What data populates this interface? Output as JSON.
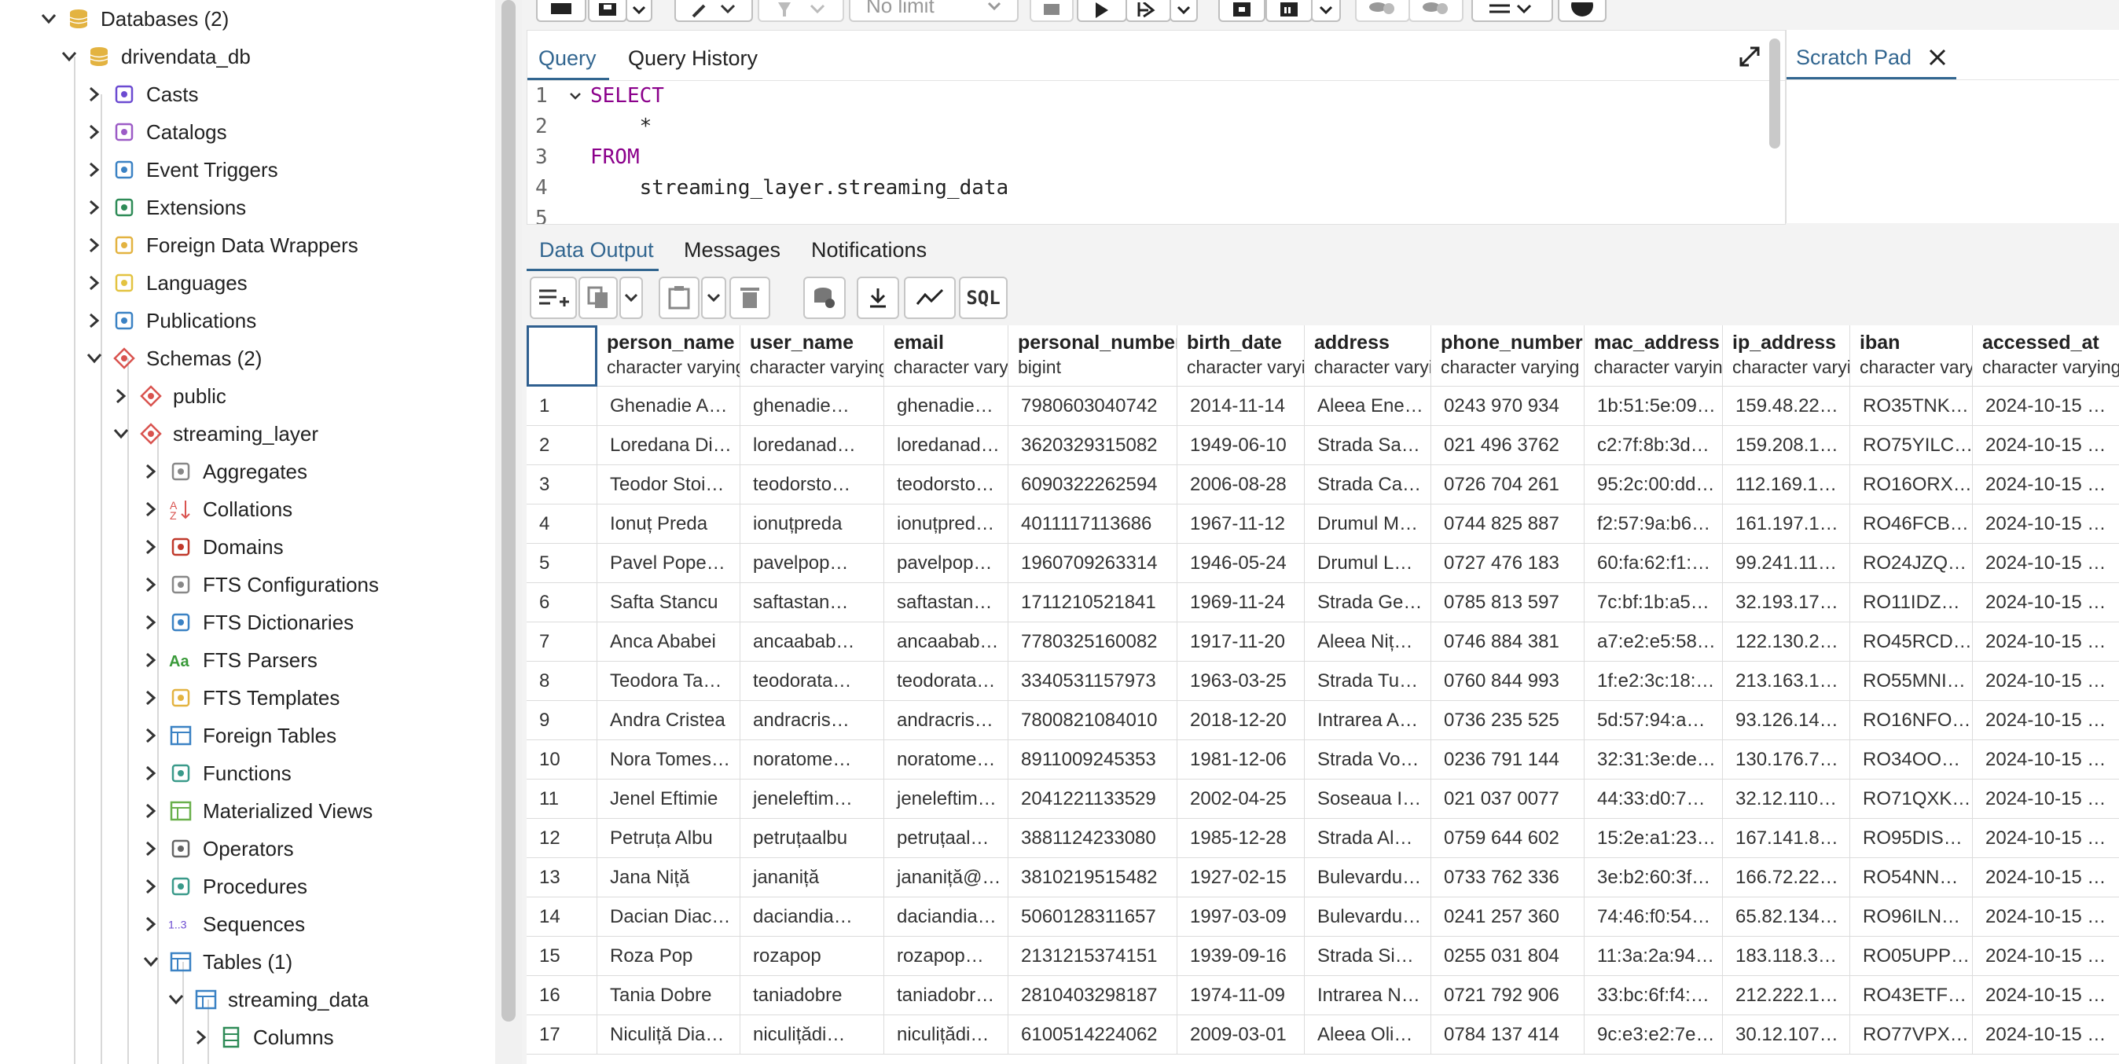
{
  "sidebar": {
    "items": [
      {
        "label": "Databases (2)",
        "icon": "databases-icon",
        "state": "expanded"
      },
      {
        "label": "drivendata_db",
        "icon": "database-icon",
        "state": "expanded"
      },
      {
        "label": "Casts",
        "icon": "casts-icon",
        "state": "collapsed"
      },
      {
        "label": "Catalogs",
        "icon": "catalogs-icon",
        "state": "collapsed"
      },
      {
        "label": "Event Triggers",
        "icon": "event-triggers-icon",
        "state": "collapsed"
      },
      {
        "label": "Extensions",
        "icon": "extensions-icon",
        "state": "collapsed"
      },
      {
        "label": "Foreign Data Wrappers",
        "icon": "foreign-data-wrappers-icon",
        "state": "collapsed"
      },
      {
        "label": "Languages",
        "icon": "languages-icon",
        "state": "collapsed"
      },
      {
        "label": "Publications",
        "icon": "publications-icon",
        "state": "collapsed"
      },
      {
        "label": "Schemas (2)",
        "icon": "schemas-icon",
        "state": "expanded"
      },
      {
        "label": "public",
        "icon": "schema-icon",
        "state": "collapsed"
      },
      {
        "label": "streaming_layer",
        "icon": "schema-icon",
        "state": "expanded"
      },
      {
        "label": "Aggregates",
        "icon": "aggregates-icon",
        "state": "collapsed"
      },
      {
        "label": "Collations",
        "icon": "collations-icon",
        "state": "collapsed"
      },
      {
        "label": "Domains",
        "icon": "domains-icon",
        "state": "collapsed"
      },
      {
        "label": "FTS Configurations",
        "icon": "fts-configurations-icon",
        "state": "collapsed"
      },
      {
        "label": "FTS Dictionaries",
        "icon": "fts-dictionaries-icon",
        "state": "collapsed"
      },
      {
        "label": "FTS Parsers",
        "icon": "fts-parsers-icon",
        "state": "collapsed"
      },
      {
        "label": "FTS Templates",
        "icon": "fts-templates-icon",
        "state": "collapsed"
      },
      {
        "label": "Foreign Tables",
        "icon": "foreign-tables-icon",
        "state": "collapsed"
      },
      {
        "label": "Functions",
        "icon": "functions-icon",
        "state": "collapsed"
      },
      {
        "label": "Materialized Views",
        "icon": "materialized-views-icon",
        "state": "collapsed"
      },
      {
        "label": "Operators",
        "icon": "operators-icon",
        "state": "collapsed"
      },
      {
        "label": "Procedures",
        "icon": "procedures-icon",
        "state": "collapsed"
      },
      {
        "label": "Sequences",
        "icon": "sequences-icon",
        "state": "collapsed"
      },
      {
        "label": "Tables (1)",
        "icon": "tables-icon",
        "state": "expanded"
      },
      {
        "label": "streaming_data",
        "icon": "table-icon",
        "state": "expanded"
      },
      {
        "label": "Columns",
        "icon": "columns-icon",
        "state": "collapsed"
      }
    ]
  },
  "toolbar": {
    "limit_value": "No limit"
  },
  "editor": {
    "tabs": [
      "Query",
      "Query History"
    ],
    "lines": [
      {
        "num": "1",
        "text": "SELECT",
        "keyword": true
      },
      {
        "num": "2",
        "text": "    *",
        "keyword": false
      },
      {
        "num": "3",
        "text": "FROM",
        "keyword": true
      },
      {
        "num": "4",
        "text": "    streaming_layer.streaming_data",
        "keyword": false
      },
      {
        "num": "5",
        "text": "",
        "keyword": false
      }
    ]
  },
  "scratch_pad": {
    "title": "Scratch Pad"
  },
  "output": {
    "tabs": [
      "Data Output",
      "Messages",
      "Notifications"
    ],
    "sql_button": "SQL"
  },
  "grid": {
    "columns": [
      {
        "name": "person_name",
        "type": "character varying"
      },
      {
        "name": "user_name",
        "type": "character varying"
      },
      {
        "name": "email",
        "type": "character varying"
      },
      {
        "name": "personal_number",
        "type": "bigint"
      },
      {
        "name": "birth_date",
        "type": "character varying"
      },
      {
        "name": "address",
        "type": "character varying"
      },
      {
        "name": "phone_number",
        "type": "character varying"
      },
      {
        "name": "mac_address",
        "type": "character varying"
      },
      {
        "name": "ip_address",
        "type": "character varying"
      },
      {
        "name": "iban",
        "type": "character varying"
      },
      {
        "name": "accessed_at",
        "type": "character varying"
      }
    ],
    "rows": [
      [
        "1",
        "Ghenadie A…",
        "ghenadie…",
        "ghenadie…",
        "7980603040742",
        "2014-11-14",
        "Aleea Ene…",
        "0243 970 934",
        "1b:51:5e:09…",
        "159.48.22…",
        "RO35TNK…",
        "2024-10-15 …"
      ],
      [
        "2",
        "Loredana Di…",
        "loredanad…",
        "loredanad…",
        "3620329315082",
        "1949-06-10",
        "Strada Sa…",
        "021 496 3762",
        "c2:7f:8b:3d…",
        "159.208.1…",
        "RO75YILC…",
        "2024-10-15 …"
      ],
      [
        "3",
        "Teodor Stoi…",
        "teodorsto…",
        "teodorsto…",
        "6090322262594",
        "2006-08-28",
        "Strada Ca…",
        "0726 704 261",
        "95:2c:00:dd…",
        "112.169.1…",
        "RO16ORX…",
        "2024-10-15 …"
      ],
      [
        "4",
        "Ionuț Preda",
        "ionuțpreda",
        "ionuțpred…",
        "4011117113686",
        "1967-11-12",
        "Drumul M…",
        "0744 825 887",
        "f2:57:9a:b6…",
        "161.197.1…",
        "RO46FCB…",
        "2024-10-15 …"
      ],
      [
        "5",
        "Pavel Pope…",
        "pavelpop…",
        "pavelpop…",
        "1960709263314",
        "1946-05-24",
        "Drumul L…",
        "0727 476 183",
        "60:fa:62:f1:…",
        "99.241.11…",
        "RO24JZQ…",
        "2024-10-15 …"
      ],
      [
        "6",
        "Safta Stancu",
        "saftastan…",
        "saftastan…",
        "1711210521841",
        "1969-11-24",
        "Strada Ge…",
        "0785 813 597",
        "7c:bf:1b:a5…",
        "32.193.17…",
        "RO11IDZ…",
        "2024-10-15 …"
      ],
      [
        "7",
        "Anca Ababei",
        "ancaabab…",
        "ancaabab…",
        "7780325160082",
        "1917-11-20",
        "Aleea Niț…",
        "0746 884 381",
        "a7:e2:e5:58…",
        "122.130.2…",
        "RO45RCD…",
        "2024-10-15 …"
      ],
      [
        "8",
        "Teodora Ta…",
        "teodorata…",
        "teodorata…",
        "3340531157973",
        "1963-03-25",
        "Strada Tu…",
        "0760 844 993",
        "1f:e2:3c:18:…",
        "213.163.1…",
        "RO55MNI…",
        "2024-10-15 …"
      ],
      [
        "9",
        "Andra Cristea",
        "andracris…",
        "andracris…",
        "7800821084010",
        "2018-12-20",
        "Intrarea A…",
        "0736 235 525",
        "5d:57:94:a…",
        "93.126.14…",
        "RO16NFO…",
        "2024-10-15 …"
      ],
      [
        "10",
        "Nora Tomes…",
        "noratome…",
        "noratome…",
        "8911009245353",
        "1981-12-06",
        "Strada Vo…",
        "0236 791 144",
        "32:31:3e:de…",
        "130.176.7…",
        "RO34OO…",
        "2024-10-15 …"
      ],
      [
        "11",
        "Jenel Eftimie",
        "jeneleftim…",
        "jeneleftim…",
        "2041221133529",
        "2002-04-25",
        "Soseaua I…",
        "021 037 0077",
        "44:33:d0:7…",
        "32.12.110…",
        "RO71QXK…",
        "2024-10-15 …"
      ],
      [
        "12",
        "Petruța Albu",
        "petruțaalbu",
        "petruțaal…",
        "3881124233080",
        "1985-12-28",
        "Strada Al…",
        "0759 644 602",
        "15:2e:a1:23…",
        "167.141.8…",
        "RO95DIS…",
        "2024-10-15 …"
      ],
      [
        "13",
        "Jana Niță",
        "jananiță",
        "jananiță@…",
        "3810219515482",
        "1927-02-15",
        "Bulevardu…",
        "0733 762 336",
        "3e:b2:60:3f…",
        "166.72.22…",
        "RO54NN…",
        "2024-10-15 …"
      ],
      [
        "14",
        "Dacian Diac…",
        "daciandia…",
        "daciandia…",
        "5060128311657",
        "1997-03-09",
        "Bulevardu…",
        "0241 257 360",
        "74:46:f0:54…",
        "65.82.134…",
        "RO96ILN…",
        "2024-10-15 …"
      ],
      [
        "15",
        "Roza Pop",
        "rozapop",
        "rozapop…",
        "2131215374151",
        "1939-09-16",
        "Strada Si…",
        "0255 031 804",
        "11:3a:2a:94…",
        "183.118.3…",
        "RO05UPP…",
        "2024-10-15 …"
      ],
      [
        "16",
        "Tania Dobre",
        "taniadobre",
        "taniadobr…",
        "2810403298187",
        "1974-11-09",
        "Intrarea N…",
        "0721 792 906",
        "33:bc:6f:f4:…",
        "212.222.1…",
        "RO43ETF…",
        "2024-10-15 …"
      ],
      [
        "17",
        "Niculiță Dia…",
        "niculițădi…",
        "niculițădi…",
        "6100514224062",
        "2009-03-01",
        "Aleea Oli…",
        "0784 137 414",
        "9c:e3:e2:7e…",
        "30.12.107…",
        "RO77VPX…",
        "2024-10-15 …"
      ]
    ]
  },
  "colors": {
    "accent": "#326690",
    "keyword": "#8b008b",
    "db_icon": "#e3b341",
    "schema_icon": "#d9534f",
    "grid_border": "#dcdcdc"
  }
}
